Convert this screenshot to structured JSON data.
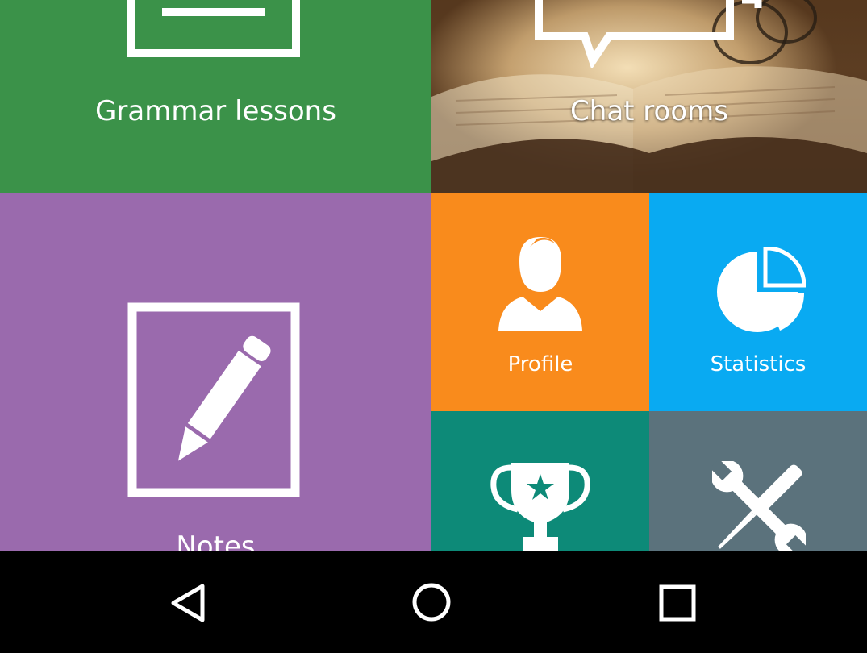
{
  "tiles": {
    "grammar": {
      "label": "Grammar lessons",
      "icon": "document-icon",
      "color": "#3b9249"
    },
    "chat": {
      "label": "Chat rooms",
      "icon": "speech-bubbles-icon"
    },
    "notes": {
      "label": "Notes",
      "icon": "pencil-icon",
      "color": "#9a6aad"
    },
    "profile": {
      "label": "Profile",
      "icon": "person-icon",
      "color": "#f98b1c"
    },
    "stats": {
      "label": "Statistics",
      "icon": "pie-chart-icon",
      "color": "#09aaf2"
    },
    "achievements": {
      "label": "",
      "icon": "trophy-icon",
      "color": "#0d8a78"
    },
    "settings": {
      "label": "",
      "icon": "tools-icon",
      "color": "#5b727c"
    }
  },
  "navbar": {
    "buttons": [
      {
        "icon": "back-icon"
      },
      {
        "icon": "home-icon"
      },
      {
        "icon": "recents-icon"
      }
    ]
  }
}
